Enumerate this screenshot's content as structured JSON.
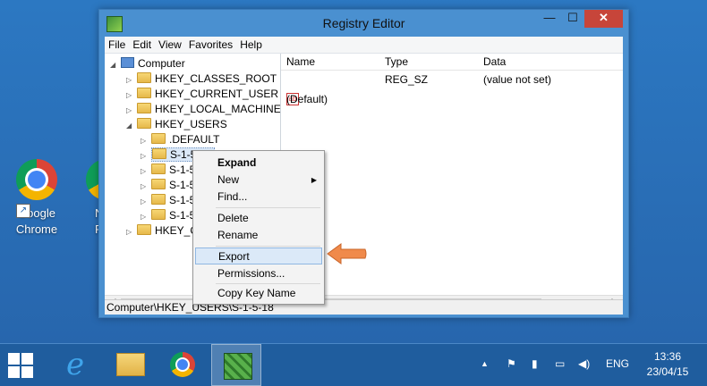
{
  "window": {
    "title": "Registry Editor",
    "minimize": "—",
    "maximize": "☐",
    "close": "✕"
  },
  "menu": [
    "File",
    "Edit",
    "View",
    "Favorites",
    "Help"
  ],
  "tree": {
    "root": "Computer",
    "keys": [
      "HKEY_CLASSES_ROOT",
      "HKEY_CURRENT_USER",
      "HKEY_LOCAL_MACHINE",
      "HKEY_USERS"
    ],
    "users_children": [
      ".DEFAULT",
      "S-1-5-18",
      "S-1-5-",
      "S-1-5-",
      "S-1-5-",
      "S-1-5-"
    ],
    "last": "HKEY_CU"
  },
  "columns": [
    "Name",
    "Type",
    "Data"
  ],
  "rows": [
    {
      "name": "(Default)",
      "type": "REG_SZ",
      "data": "(value not set)"
    }
  ],
  "context_menu": {
    "items": [
      "Expand",
      "New",
      "Find...",
      "Delete",
      "Rename",
      "Export",
      "Permissions...",
      "Copy Key Name"
    ],
    "highlighted": "Export",
    "submenu_arrow": "▶"
  },
  "status": "Computer\\HKEY_USERS\\S-1-5-18",
  "desktop": {
    "chrome_label_1": "Google",
    "chrome_label_2": "Chrome",
    "partial_1": "N",
    "partial_2": "F"
  },
  "taskbar": {
    "language": "ENG",
    "time": "13:36",
    "date": "23/04/15",
    "show_hidden": "▲"
  },
  "colors": {
    "accent": "#4a90d0",
    "close_red": "#c7453a",
    "arrow_orange": "#f08a4b"
  }
}
